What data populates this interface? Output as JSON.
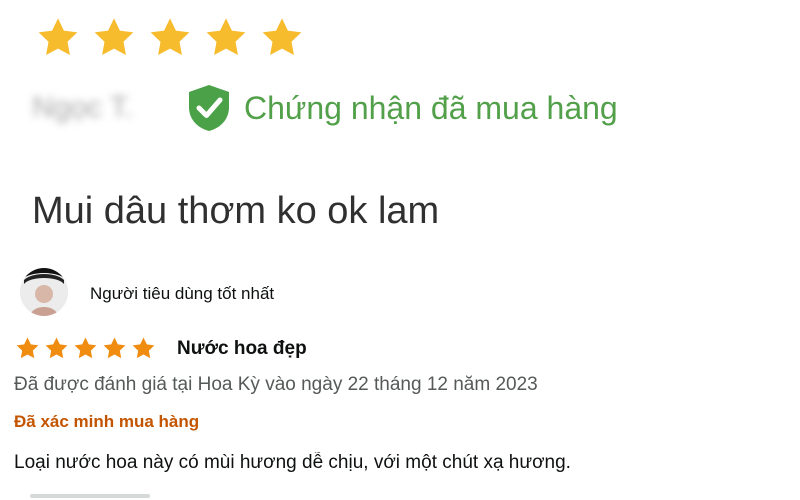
{
  "top_review": {
    "rating": 5,
    "reviewer_name": "Ngọc T.",
    "verified_label": "Chứng nhận đã mua hàng",
    "title": "Mui dâu thơm ko ok lam",
    "colors": {
      "star": "#f7bb2e",
      "verified": "#52a049"
    }
  },
  "review": {
    "profile_name": "Người tiêu dùng tốt nhất",
    "rating": 5,
    "title": "Nước hoa đẹp",
    "date": "Đã được đánh giá tại Hoa Kỳ vào ngày 22 tháng 12 năm 2023",
    "verified": "Đã xác minh mua hàng",
    "body": "Loại nước hoa này có mùi hương dễ chịu, với một chút xạ hương.",
    "colors": {
      "star": "#f08c0f",
      "verified": "#c45500"
    }
  },
  "icons": {
    "star": "star-icon",
    "shield": "shield-check-icon",
    "avatar": "user-avatar-icon"
  }
}
